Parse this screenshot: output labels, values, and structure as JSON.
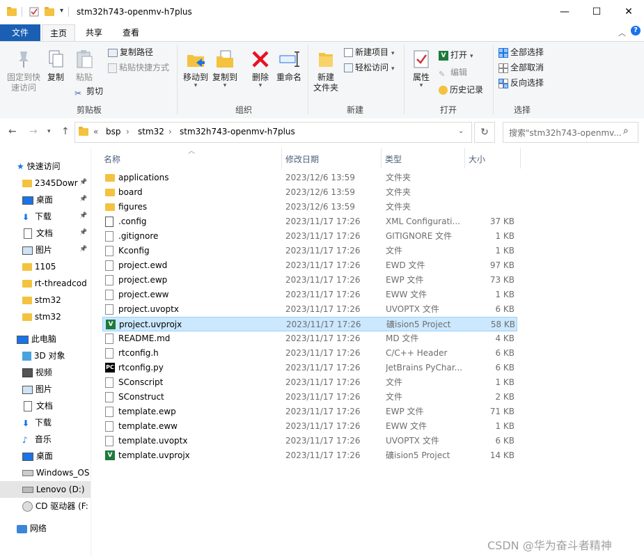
{
  "window": {
    "title": "stm32h743-openmv-h7plus",
    "minimize": "—",
    "maximize": "☐",
    "close": "✕"
  },
  "tabs": [
    {
      "label": "文件"
    },
    {
      "label": "主页"
    },
    {
      "label": "共享"
    },
    {
      "label": "查看"
    }
  ],
  "ribbon": {
    "clipboard": {
      "pin_quick": "固定到快\n速访问",
      "copy": "复制",
      "paste": "粘贴",
      "copy_path": "复制路径",
      "paste_shortcut": "粘贴快捷方式",
      "cut": "剪切",
      "label": "剪贴板"
    },
    "organize": {
      "move_to": "移动到",
      "copy_to": "复制到",
      "delete": "删除",
      "rename": "重命名",
      "label": "组织"
    },
    "new": {
      "new_folder": "新建\n文件夹",
      "new_item": "新建项目",
      "easy_access": "轻松访问",
      "label": "新建"
    },
    "open": {
      "properties": "属性",
      "open": "打开",
      "edit": "编辑",
      "history": "历史记录",
      "label": "打开"
    },
    "select": {
      "select_all": "全部选择",
      "select_none": "全部取消",
      "invert": "反向选择",
      "label": "选择"
    }
  },
  "address": {
    "overflow": "«",
    "crumbs": [
      "bsp",
      "stm32",
      "stm32h743-openmv-h7plus"
    ],
    "search_placeholder": "搜索\"stm32h743-openmv..."
  },
  "sidebar": {
    "quick_access": "快速访问",
    "quick_items": [
      "2345Dowr",
      "桌面",
      "下载",
      "文档",
      "图片",
      "1105",
      "rt-threadcod",
      "stm32",
      "stm32"
    ],
    "this_pc": "此电脑",
    "pc_items": [
      "3D 对象",
      "视频",
      "图片",
      "文档",
      "下载",
      "音乐",
      "桌面",
      "Windows_OS",
      "Lenovo (D:)",
      "CD 驱动器 (F:"
    ],
    "network": "网络"
  },
  "columns": {
    "name": "名称",
    "date": "修改日期",
    "type": "类型",
    "size": "大小"
  },
  "files": [
    {
      "name": "applications",
      "date": "2023/12/6 13:59",
      "type": "文件夹",
      "size": "",
      "icon": "folder"
    },
    {
      "name": "board",
      "date": "2023/12/6 13:59",
      "type": "文件夹",
      "size": "",
      "icon": "folder"
    },
    {
      "name": "figures",
      "date": "2023/12/6 13:59",
      "type": "文件夹",
      "size": "",
      "icon": "folder"
    },
    {
      "name": ".config",
      "date": "2023/11/17 17:26",
      "type": "XML Configurati...",
      "size": "37 KB",
      "icon": "xml"
    },
    {
      "name": ".gitignore",
      "date": "2023/11/17 17:26",
      "type": "GITIGNORE 文件",
      "size": "1 KB",
      "icon": "doc"
    },
    {
      "name": "Kconfig",
      "date": "2023/11/17 17:26",
      "type": "文件",
      "size": "1 KB",
      "icon": "doc"
    },
    {
      "name": "project.ewd",
      "date": "2023/11/17 17:26",
      "type": "EWD 文件",
      "size": "97 KB",
      "icon": "doc"
    },
    {
      "name": "project.ewp",
      "date": "2023/11/17 17:26",
      "type": "EWP 文件",
      "size": "73 KB",
      "icon": "doc"
    },
    {
      "name": "project.eww",
      "date": "2023/11/17 17:26",
      "type": "EWW 文件",
      "size": "1 KB",
      "icon": "doc"
    },
    {
      "name": "project.uvoptx",
      "date": "2023/11/17 17:26",
      "type": "UVOPTX 文件",
      "size": "6 KB",
      "icon": "doc"
    },
    {
      "name": "project.uvprojx",
      "date": "2023/11/17 17:26",
      "type": "礦ision5 Project",
      "size": "58 KB",
      "icon": "keil"
    },
    {
      "name": "README.md",
      "date": "2023/11/17 17:26",
      "type": "MD 文件",
      "size": "4 KB",
      "icon": "doc"
    },
    {
      "name": "rtconfig.h",
      "date": "2023/11/17 17:26",
      "type": "C/C++ Header",
      "size": "6 KB",
      "icon": "header"
    },
    {
      "name": "rtconfig.py",
      "date": "2023/11/17 17:26",
      "type": "JetBrains PyChar...",
      "size": "6 KB",
      "icon": "pycharm"
    },
    {
      "name": "SConscript",
      "date": "2023/11/17 17:26",
      "type": "文件",
      "size": "1 KB",
      "icon": "doc"
    },
    {
      "name": "SConstruct",
      "date": "2023/11/17 17:26",
      "type": "文件",
      "size": "2 KB",
      "icon": "doc"
    },
    {
      "name": "template.ewp",
      "date": "2023/11/17 17:26",
      "type": "EWP 文件",
      "size": "71 KB",
      "icon": "doc"
    },
    {
      "name": "template.eww",
      "date": "2023/11/17 17:26",
      "type": "EWW 文件",
      "size": "1 KB",
      "icon": "doc"
    },
    {
      "name": "template.uvoptx",
      "date": "2023/11/17 17:26",
      "type": "UVOPTX 文件",
      "size": "6 KB",
      "icon": "doc"
    },
    {
      "name": "template.uvprojx",
      "date": "2023/11/17 17:26",
      "type": "礦ision5 Project",
      "size": "14 KB",
      "icon": "keil"
    }
  ],
  "selected_file_index": 10,
  "watermark": "CSDN @华为奋斗者精神",
  "colors": {
    "accent": "#1a5fb4",
    "selection": "#cce8ff",
    "folder": "#f3c23f"
  }
}
